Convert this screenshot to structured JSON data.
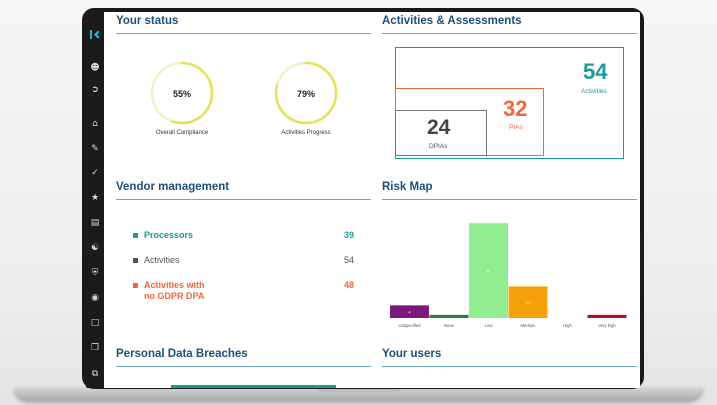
{
  "status": {
    "title": "Your status",
    "overall_compliance": {
      "value": "55%",
      "label": "Overall Compliance",
      "fraction": 0.55
    },
    "activities_progress": {
      "value": "79%",
      "label": "Activities Progress",
      "fraction": 0.79
    }
  },
  "activities": {
    "title": "Activities & Assessments",
    "total": {
      "value": "54",
      "label": "Activities"
    },
    "pias": {
      "value": "32",
      "label": "PIAs"
    },
    "dpias": {
      "value": "24",
      "label": "DPIAs"
    }
  },
  "vendor": {
    "title": "Vendor management",
    "rows": [
      {
        "label": "Processors",
        "value": "39",
        "color": "#1a9a9a"
      },
      {
        "label": "Activities",
        "value": "54",
        "color": "#555555"
      },
      {
        "label": "Activities with",
        "label2": "no GDPR DPA",
        "value": "48",
        "color": "#f2673a"
      }
    ]
  },
  "risk_map": {
    "title": "Risk Map"
  },
  "breaches": {
    "title": "Personal Data Breaches"
  },
  "users": {
    "title": "Your users"
  },
  "sidebar_icons": [
    "logo-icon",
    "user-icon",
    "logout-icon",
    "home-icon",
    "edit-icon",
    "check-icon",
    "star-icon",
    "chart-icon",
    "handshake-icon",
    "shield-icon",
    "location-icon",
    "document-icon",
    "documents-icon",
    "share-icon"
  ],
  "colors": {
    "accent_teal": "#1a9a9a",
    "title_blue": "#1f4e79",
    "orange": "#f2673a",
    "ring_yellow": "#e8e05a"
  },
  "chart_data": {
    "type": "bar",
    "categories": [
      "Unspecified",
      "None",
      "Low",
      "Medium",
      "High",
      "Very high"
    ],
    "values": [
      4,
      1,
      30,
      10,
      0,
      1
    ],
    "data_labels": [
      "4",
      "",
      "31",
      "12",
      "",
      ""
    ],
    "colors": [
      "#7b1a7b",
      "#2e7d32",
      "#90ee90",
      "#f5a10a",
      "#cccccc",
      "#9b1b1b"
    ],
    "title": "",
    "xlabel": "",
    "ylabel": "",
    "ylim": [
      0,
      31
    ],
    "grid": false
  }
}
